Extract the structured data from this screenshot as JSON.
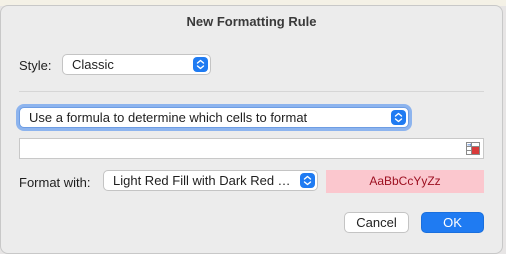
{
  "dialog": {
    "title": "New Formatting Rule"
  },
  "style": {
    "label": "Style:",
    "value": "Classic"
  },
  "rule_type": {
    "value": "Use a formula to determine which cells to format"
  },
  "formula": {
    "value": ""
  },
  "format_with": {
    "label": "Format with:",
    "value": "Light Red Fill with Dark Red Text",
    "preview_text": "AaBbCcYyZz",
    "preview_fill": "#fbc7ce",
    "preview_text_color": "#9c0e1f"
  },
  "buttons": {
    "cancel": "Cancel",
    "ok": "OK"
  },
  "colors": {
    "accent": "#1f7bf2"
  },
  "icons": {
    "popup_arrows": "up-down-chevron-icon",
    "range_picker": "range-picker-icon"
  }
}
